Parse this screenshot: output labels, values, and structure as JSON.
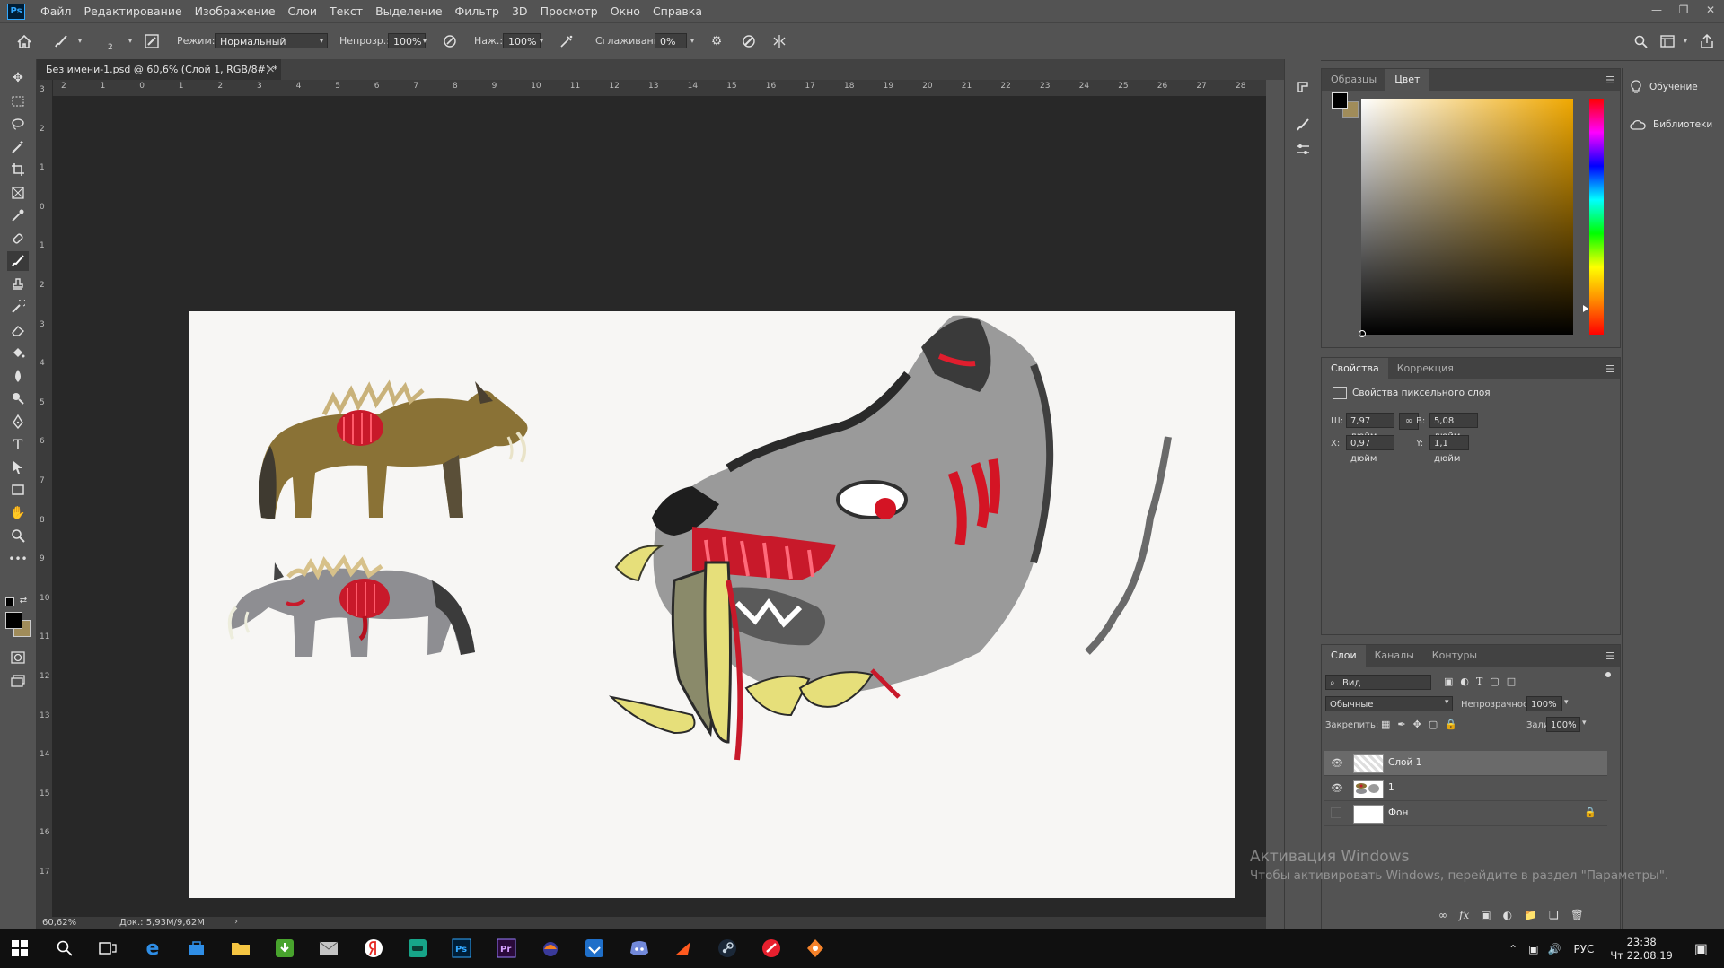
{
  "menubar": {
    "items": [
      "Файл",
      "Редактирование",
      "Изображение",
      "Слои",
      "Текст",
      "Выделение",
      "Фильтр",
      "3D",
      "Просмотр",
      "Окно",
      "Справка"
    ]
  },
  "options": {
    "brush_size": "2",
    "mode_label": "Режим:",
    "mode_value": "Нормальный",
    "opacity_label": "Непрозр.:",
    "opacity_value": "100%",
    "pressure_label": "Наж.:",
    "pressure_value": "100%",
    "smoothing_label": "Сглаживание:",
    "smoothing_value": "0%"
  },
  "document": {
    "tab_title": "Без имени-1.psd @ 60,6% (Слой 1, RGB/8#) *",
    "zoom": "60,62%",
    "doc_info": "Док.: 5,93M/9,62M",
    "ruler_top": [
      "2",
      "1",
      "0",
      "1",
      "2",
      "3",
      "4",
      "5",
      "6",
      "7",
      "8",
      "9",
      "10",
      "11",
      "12",
      "13",
      "14",
      "15",
      "16",
      "17",
      "18",
      "19",
      "20",
      "21",
      "22",
      "23",
      "24",
      "25",
      "26",
      "27",
      "28"
    ],
    "ruler_left": [
      "3",
      "2",
      "1",
      "0",
      "1",
      "2",
      "3",
      "4",
      "5",
      "6",
      "7",
      "8",
      "9",
      "10",
      "11",
      "12",
      "13",
      "14",
      "15",
      "16",
      "17"
    ]
  },
  "color_panel": {
    "tabs": [
      "Образцы",
      "Цвет"
    ],
    "active_tab": "Цвет",
    "foreground": "#000000",
    "background": "#a08c5a",
    "hue_color": "#f0a800"
  },
  "properties_panel": {
    "tabs": [
      "Свойства",
      "Коррекция"
    ],
    "active_tab": "Свойства",
    "section_title": "Свойства пиксельного слоя",
    "w_label": "Ш:",
    "w_value": "7,97 дюйм",
    "h_label": "В:",
    "h_value": "5,08 дюйм",
    "x_label": "X:",
    "x_value": "0,97 дюйм",
    "y_label": "Y:",
    "y_value": "1,1 дюйм"
  },
  "layers_panel": {
    "tabs": [
      "Слои",
      "Каналы",
      "Контуры"
    ],
    "active_tab": "Слои",
    "filter_value": "Вид",
    "blend_mode": "Обычные",
    "opacity_label": "Непрозрачность:",
    "opacity_value": "100%",
    "lock_label": "Закрепить:",
    "fill_label": "Заливка:",
    "fill_value": "100%",
    "layers": [
      {
        "name": "Слой 1",
        "visible": true,
        "selected": true
      },
      {
        "name": "1",
        "visible": true,
        "selected": false
      },
      {
        "name": "Фон",
        "visible": false,
        "selected": false,
        "locked": true
      }
    ]
  },
  "right_dock": {
    "learn": "Обучение",
    "libraries": "Библиотеки"
  },
  "activation": {
    "title": "Активация Windows",
    "subtitle": "Чтобы активировать Windows, перейдите в раздел \"Параметры\"."
  },
  "taskbar": {
    "lang": "РУС",
    "time": "23:38",
    "date": "Чт 22.08.19"
  }
}
